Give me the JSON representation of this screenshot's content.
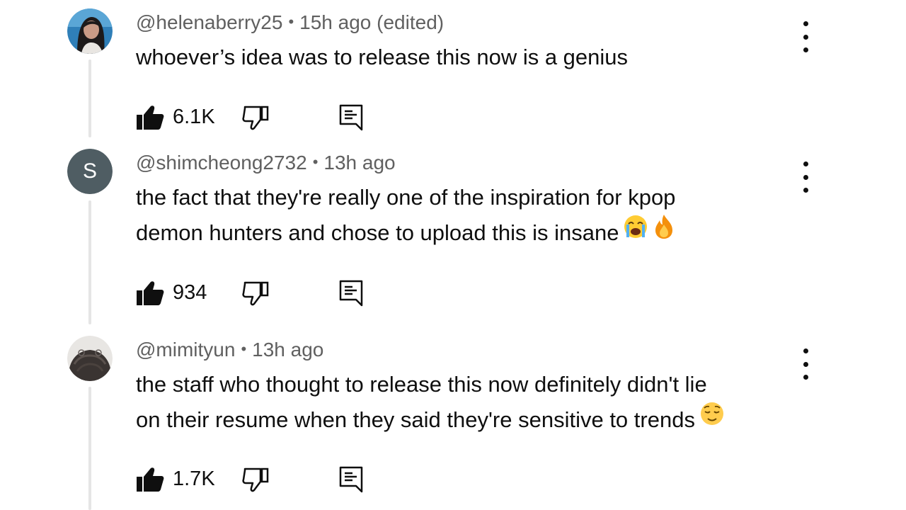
{
  "comments": [
    {
      "handle": "@helenaberry25",
      "separator": "•",
      "time": "15h ago (edited)",
      "lines": [
        "whoever’s idea was to release this now is a genius"
      ],
      "likes": "6.1K",
      "avatar": {
        "type": "photo",
        "icon": "woman-portrait"
      }
    },
    {
      "handle": "@shimcheong2732",
      "separator": "•",
      "time": "13h ago",
      "lines": [
        "the fact that they're really one of the inspiration for kpop",
        "demon hunters and chose to upload this is insane"
      ],
      "emojis": [
        "loudly-crying-face",
        "fire"
      ],
      "likes": "934",
      "avatar": {
        "type": "letter",
        "letter": "S",
        "color": "#4f5d63"
      }
    },
    {
      "handle": "@mimityun",
      "separator": "•",
      "time": "13h ago",
      "lines": [
        "the staff who thought to release this now definitely didn't lie",
        "on their resume when they said they're sensitive to trends"
      ],
      "emojis": [
        "relieved-face"
      ],
      "likes": "1.7K",
      "avatar": {
        "type": "photo",
        "icon": "dark-hair-portrait"
      }
    }
  ],
  "icons": {
    "like": "thumbs-up-filled",
    "dislike": "thumbs-down-outline",
    "reply": "reply-comment",
    "menu": "more-vertical"
  },
  "colors": {
    "text": "#0f0f0f",
    "meta": "#606060",
    "thread_line": "#e5e5e5"
  }
}
